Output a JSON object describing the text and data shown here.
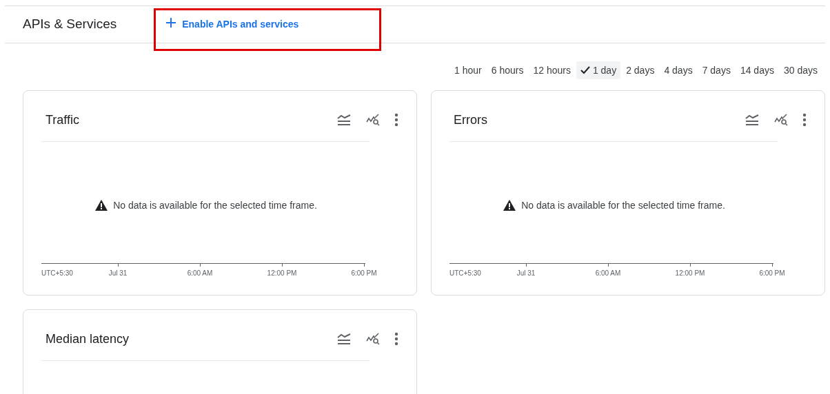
{
  "header": {
    "title": "APIs & Services",
    "action": {
      "label": "Enable APIs and services",
      "highlighted": true
    }
  },
  "time_ranges": [
    {
      "label": "1 hour",
      "selected": false
    },
    {
      "label": "6 hours",
      "selected": false
    },
    {
      "label": "12 hours",
      "selected": false
    },
    {
      "label": "1 day",
      "selected": true
    },
    {
      "label": "2 days",
      "selected": false
    },
    {
      "label": "4 days",
      "selected": false
    },
    {
      "label": "7 days",
      "selected": false
    },
    {
      "label": "14 days",
      "selected": false
    },
    {
      "label": "30 days",
      "selected": false
    }
  ],
  "cards": [
    {
      "title": "Traffic",
      "message": "No data is available for the selected time frame.",
      "x_axis_labels": [
        "UTC+5:30",
        "Jul 31",
        "6:00 AM",
        "12:00 PM",
        "6:00 PM"
      ]
    },
    {
      "title": "Errors",
      "message": "No data is available for the selected time frame.",
      "x_axis_labels": [
        "UTC+5:30",
        "Jul 31",
        "6:00 AM",
        "12:00 PM",
        "6:00 PM"
      ]
    },
    {
      "title": "Median latency"
    }
  ]
}
